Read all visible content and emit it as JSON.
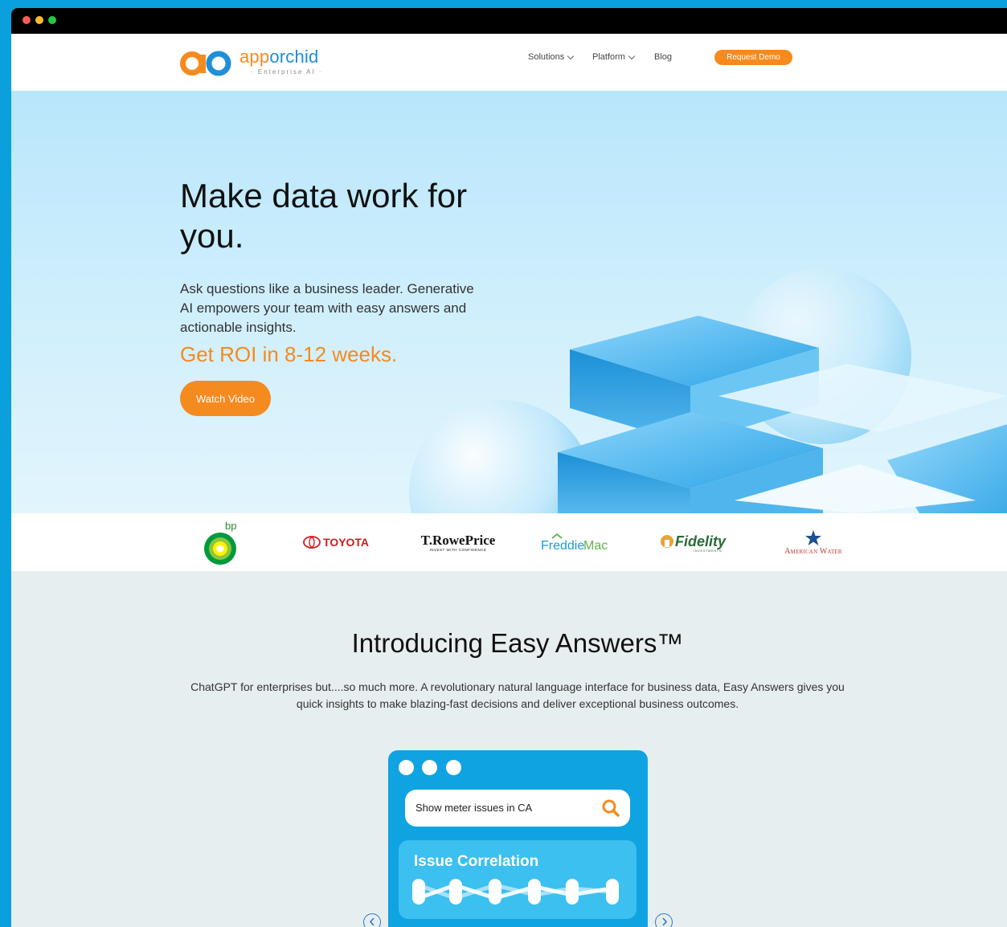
{
  "brand": {
    "name_prefix": "app",
    "name_suffix": "orchid",
    "tagline": "· Enterprise AI ·",
    "orange": "#f58a1f",
    "blue": "#1e8fd8"
  },
  "nav": {
    "solutions": "Solutions",
    "platform": "Platform",
    "blog": "Blog",
    "cta": "Request Demo"
  },
  "hero": {
    "title": "Make data work for you.",
    "subtitle": "Ask questions like a business leader. Generative AI empowers your team with easy answers and actionable insights.",
    "roi": "Get ROI in 8-12 weeks.",
    "cta": "Watch Video"
  },
  "clients": {
    "bp": "bp",
    "toyota": "TOYOTA",
    "trowe": "T.RowePrice",
    "trowe_tag": "INVEST WITH CONFIDENCE",
    "freddie_a": "Freddie",
    "freddie_b": "Mac",
    "fidelity": "Fidelity",
    "fidelity_tag": "INVESTMENTS",
    "american_water": "American Water"
  },
  "intro": {
    "title": "Introducing Easy Answers™",
    "text": "ChatGPT for enterprises but....so much more. A revolutionary natural language interface for business data, Easy Answers gives you quick insights to make blazing-fast decisions and deliver exceptional business outcomes."
  },
  "demo": {
    "query": "Show meter issues in CA",
    "card_title": "Issue Correlation"
  },
  "icons": {
    "search": "search-icon",
    "prev": "chevron-left-icon",
    "next": "chevron-right-icon"
  }
}
